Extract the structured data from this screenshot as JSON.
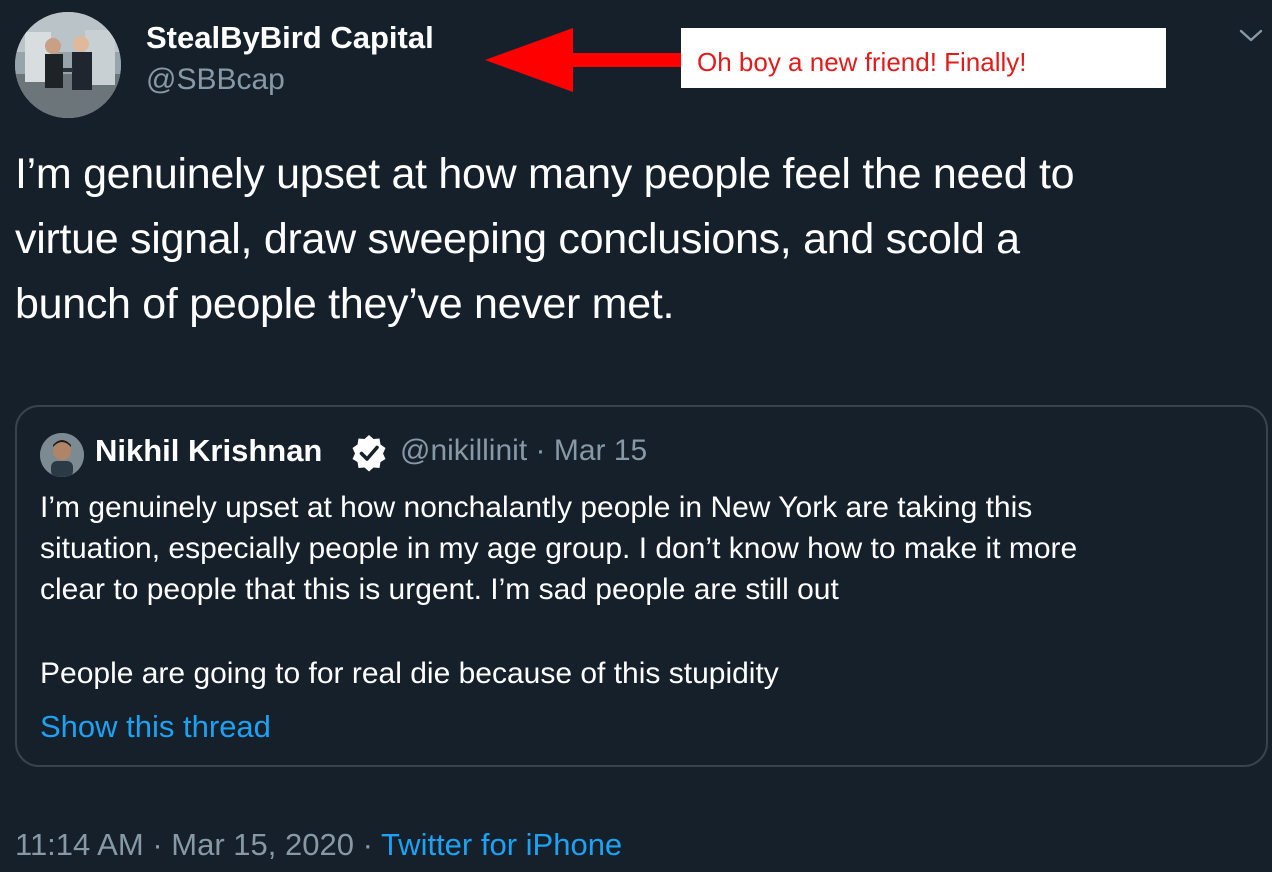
{
  "author": {
    "display_name": "StealByBird Capital",
    "handle": "@SBBcap"
  },
  "annotation": {
    "text": "Oh boy a new friend! Finally!",
    "arrow_color": "#ff0000",
    "text_color": "#e31b1b"
  },
  "tweet": {
    "lines": [
      "I’m genuinely upset at how many people feel the need to",
      "virtue signal, draw sweeping conclusions, and scold a",
      "bunch of people they’ve never met."
    ]
  },
  "quoted_tweet": {
    "display_name": "Nikhil Krishnan",
    "handle": "@nikillinit",
    "separator": "·",
    "date": "Mar 15",
    "body_lines": [
      "I’m genuinely upset at how nonchalantly people in New York are taking this",
      "situation, especially people in my age group. I don’t know how to make it more",
      "clear to people that this is urgent. I’m sad people are still out"
    ],
    "body_paragraph_2": "People are going to for real die because of this stupidity",
    "show_thread_label": "Show this thread"
  },
  "footer": {
    "time": "11:14 AM",
    "separator": "·",
    "date": "Mar 15, 2020",
    "source": "Twitter for iPhone"
  },
  "icons": {
    "caret": "chevron-down-icon",
    "verified": "verified-badge-icon"
  },
  "colors": {
    "background": "#15202b",
    "link": "#1da1f2",
    "secondary_text": "#8899a6",
    "border": "#38444d"
  }
}
